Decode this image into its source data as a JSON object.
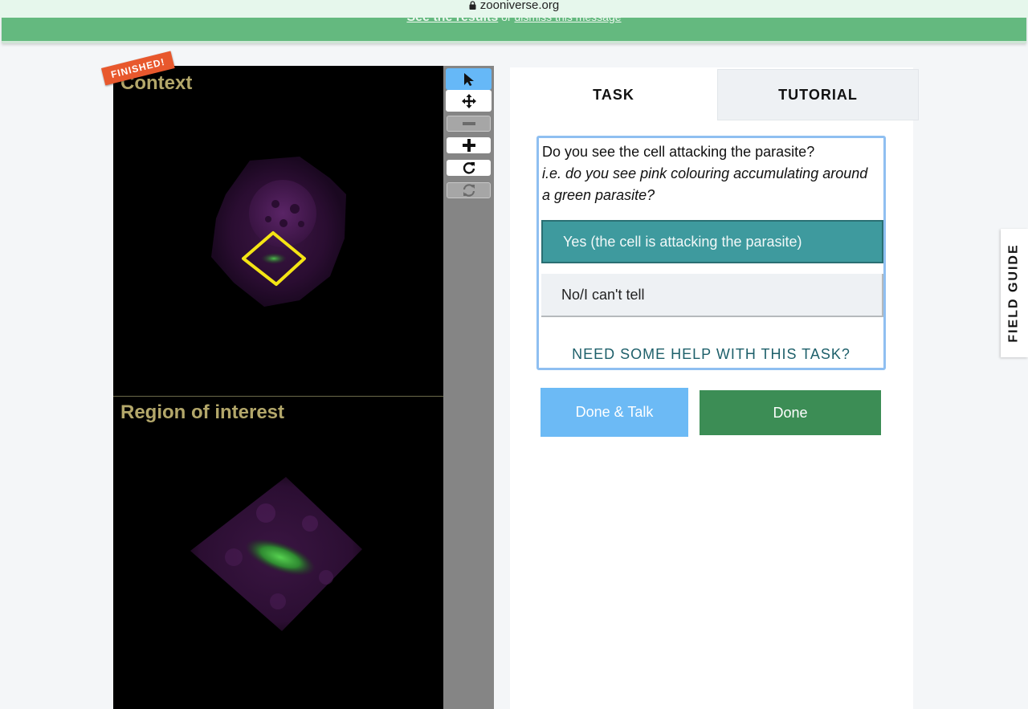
{
  "browser": {
    "url": "zooniverse.org"
  },
  "banner": {
    "results_link": "See the results",
    "or_text": "or",
    "dismiss_link": "dismiss this message"
  },
  "subject": {
    "badge": "FINISHED!",
    "frames": [
      {
        "label": "Context"
      },
      {
        "label": "Region of interest"
      }
    ]
  },
  "toolbar": {
    "tools": [
      {
        "name": "pointer-tool",
        "state": "active"
      },
      {
        "name": "pan-tool",
        "state": "enabled"
      },
      {
        "name": "zoom-out-tool",
        "state": "disabled"
      },
      {
        "name": "zoom-in-tool",
        "state": "enabled"
      },
      {
        "name": "rotate-tool",
        "state": "enabled"
      },
      {
        "name": "reset-tool",
        "state": "disabled"
      }
    ]
  },
  "tabs": {
    "task": "TASK",
    "tutorial": "TUTORIAL"
  },
  "task": {
    "question": "Do you see the cell attacking the parasite?",
    "help_text": "i.e. do you see pink colouring accumulating around a green parasite?",
    "answers": [
      {
        "label": "Yes (the cell is attacking the parasite)",
        "selected": true
      },
      {
        "label": "No/I can't tell",
        "selected": false
      }
    ],
    "need_help": "NEED SOME HELP WITH THIS TASK?"
  },
  "actions": {
    "done_talk": "Done & Talk",
    "done": "Done"
  },
  "field_guide": "FIELD GUIDE",
  "colors": {
    "banner": "#64b97f",
    "selected_answer": "#3e9a9e",
    "done_button": "#3c8d55",
    "done_talk_button": "#6cbaf5",
    "frame_label": "#b3a76a",
    "finished_badge": "#e8582d"
  }
}
